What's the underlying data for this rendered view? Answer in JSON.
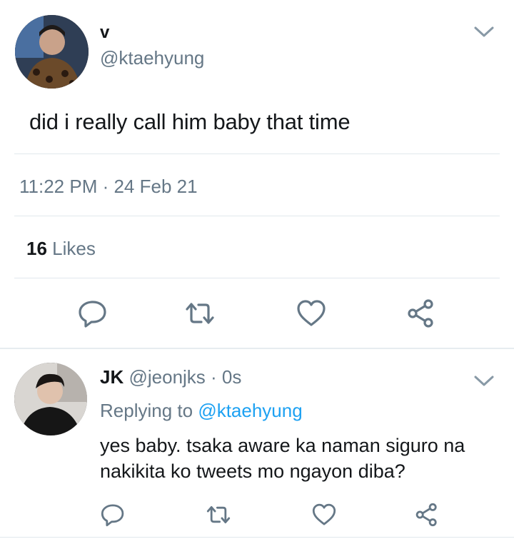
{
  "main_tweet": {
    "name": "v",
    "handle": "@ktaehyung",
    "text": "did i really call him baby that time",
    "timestamp": "11:22 PM · 24 Feb 21",
    "likes_count": "16",
    "likes_label": " Likes"
  },
  "reply": {
    "name": "JK",
    "handle": " @jeonjks",
    "time": " · 0s",
    "replying_prefix": "Replying to ",
    "replying_to": "@ktaehyung",
    "text_line1": "yes baby. tsaka aware ka naman siguro na",
    "text_line2": "nakikita ko tweets mo ngayon diba?"
  },
  "icons": {
    "reply": "reply-icon",
    "retweet": "retweet-icon",
    "like": "heart-icon",
    "share": "share-icon",
    "menu": "chevron-down-icon"
  },
  "colors": {
    "text": "#14171a",
    "secondary": "#657786",
    "link": "#1da1f2",
    "icon": "#657786",
    "divider": "#e1e8ed"
  }
}
